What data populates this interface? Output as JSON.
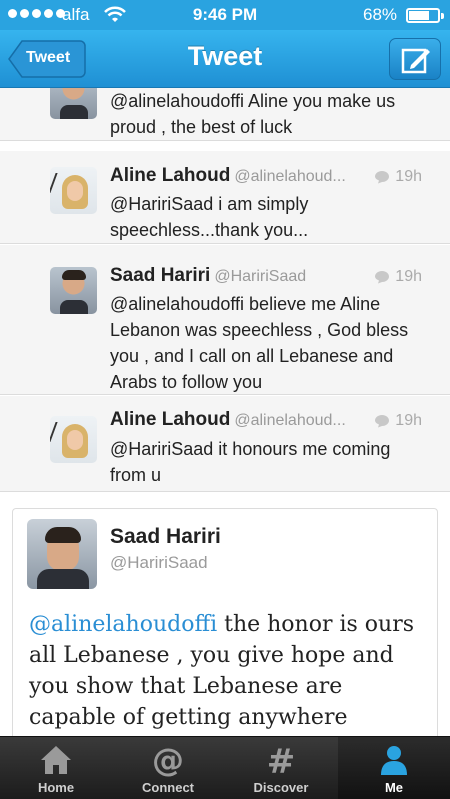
{
  "status_bar": {
    "carrier": "alfa",
    "time": "9:46 PM",
    "battery": "68%",
    "battery_level": 0.68
  },
  "nav": {
    "back_label": "Tweet",
    "title": "Tweet"
  },
  "timeline": [
    {
      "name": "",
      "handle": "",
      "time": "",
      "text": "@alinelahoudoffi Aline you make us proud , the best of luck"
    },
    {
      "name": "Aline Lahoud",
      "handle": "@alinelahoud...",
      "time": "19h",
      "text": "@HaririSaad i am simply speechless...thank you..."
    },
    {
      "name": "Saad Hariri",
      "handle": "@HaririSaad",
      "time": "19h",
      "text": "@alinelahoudoffi believe me Aline Lebanon was speechless , God bless you , and I call on all Lebanese and Arabs  to follow you"
    },
    {
      "name": "Aline Lahoud",
      "handle": "@alinelahoud...",
      "time": "19h",
      "text": "@HaririSaad it honours me coming from u"
    }
  ],
  "detail": {
    "name": "Saad Hariri",
    "handle": "@HaririSaad",
    "mention": "@alinelahoudoffi",
    "text": " the honor is ours all Lebanese , you give hope and you show that Lebanese are capable of getting anywhere"
  },
  "tabs": [
    {
      "label": "Home",
      "icon": "home-icon"
    },
    {
      "label": "Connect",
      "icon": "at-icon"
    },
    {
      "label": "Discover",
      "icon": "hash-icon"
    },
    {
      "label": "Me",
      "icon": "person-icon",
      "active": true
    }
  ],
  "colors": {
    "brand": "#2aa3e0",
    "mention": "#2a8ed4",
    "tabbar": "#1c1c1c"
  }
}
